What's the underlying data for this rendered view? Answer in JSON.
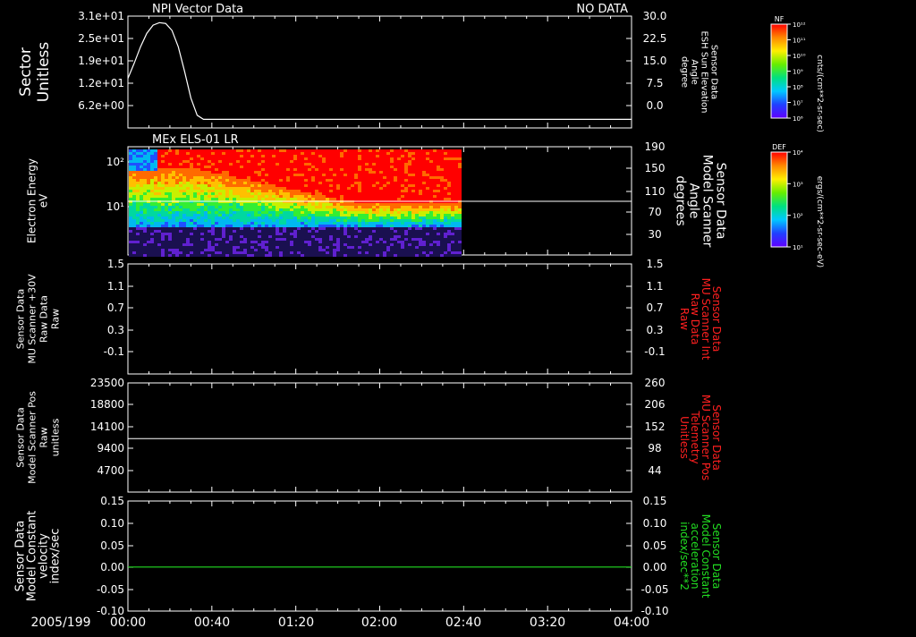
{
  "colors": {
    "background": "#000000",
    "axis": "#ffffff",
    "trace": "#ffffff",
    "red_label": "#ff2020",
    "green_label": "#22dd22"
  },
  "bottom": {
    "date": "2005/199",
    "time_ticks": [
      "00:00",
      "00:40",
      "01:20",
      "02:00",
      "02:40",
      "03:20",
      "04:00"
    ]
  },
  "colorbars": [
    {
      "title": "NF",
      "unit": "cnts/(cm**2-sr-sec)",
      "ticks": [
        "10¹²",
        "10¹¹",
        "10¹⁰",
        "10⁹",
        "10⁸",
        "10⁷",
        "10⁶"
      ]
    },
    {
      "title": "DEF",
      "unit": "ergs/(cm**2-sr-sec-eV)",
      "ticks": [
        "10⁴",
        "10³",
        "10²",
        "10¹"
      ]
    }
  ],
  "chart_data": [
    {
      "type": "line",
      "title": "NPI Vector Data",
      "status": "NO DATA",
      "ylabel": [
        "Sector",
        "Unitless"
      ],
      "yticks": [
        "3.1e+01",
        "2.5e+01",
        "1.9e+01",
        "1.2e+01",
        "6.2e+00"
      ],
      "ylim": [
        3.7,
        31
      ],
      "ylabel_right": [
        "Sensor Data",
        "ESH Sun Elevation",
        "Angle",
        "degree"
      ],
      "yticks_right": [
        "30.0",
        "22.5",
        "15.0",
        "7.5",
        "0.0"
      ],
      "x_minutes": [
        0,
        3,
        6,
        9,
        12,
        15,
        18,
        21,
        24,
        27,
        30,
        33,
        36,
        40,
        60,
        100,
        140,
        180,
        240
      ],
      "y": [
        15.8,
        19.5,
        23.5,
        26.8,
        28.8,
        29.4,
        29.2,
        27.5,
        23.5,
        17.5,
        11.0,
        6.8,
        5.8,
        5.8,
        5.8,
        5.8,
        5.8,
        5.8,
        5.8
      ]
    },
    {
      "type": "heatmap",
      "title": "MEx ELS-01 LR",
      "ylabel": [
        "Electron Energy",
        "eV"
      ],
      "yticks": [
        "10²",
        "10¹"
      ],
      "ylabel_right": [
        "Sensor Data",
        "Model Scanner",
        "Angle",
        "degrees"
      ],
      "yticks_right": [
        "190",
        "150",
        "110",
        "70",
        "30"
      ],
      "data_end_time": "02:38",
      "angle_line_degrees": 85
    },
    {
      "type": "line",
      "ylabel": [
        "Sensor Data",
        "MU Scanner +30V",
        "Raw Data",
        "Raw"
      ],
      "yticks": [
        "1.5",
        "1.1",
        "0.7",
        "0.3",
        "-0.1"
      ],
      "ylabel_right": [
        "Sensor Data",
        "MU Scanner Int",
        "Raw Data",
        "Raw"
      ],
      "yticks_right": [
        "1.5",
        "1.1",
        "0.7",
        "0.3",
        "-0.1"
      ]
    },
    {
      "type": "line",
      "ylabel": [
        "Sensor Data",
        "Model Scanner Pos",
        "Raw",
        "unitless"
      ],
      "yticks": [
        "23500",
        "18800",
        "14100",
        "9400",
        "4700"
      ],
      "ylim": [
        0,
        23500
      ],
      "ylabel_right": [
        "Sensor Data",
        "MU Scanner Pos",
        "Telemetry",
        "Unitless"
      ],
      "yticks_right": [
        "260",
        "206",
        "152",
        "98",
        "44"
      ],
      "x_minutes": [
        0,
        240
      ],
      "y": [
        11500,
        11500
      ]
    },
    {
      "type": "line",
      "ylabel": [
        "Sensor Data",
        "Model Constant",
        "velocity",
        "index/sec"
      ],
      "yticks": [
        "0.15",
        "0.10",
        "0.05",
        "0.00",
        "-0.05",
        "-0.10"
      ],
      "ylim": [
        -0.1,
        0.15
      ],
      "ylabel_right": [
        "Sensor Data",
        "Model Constant",
        "acceleration",
        "index/sec**2"
      ],
      "yticks_right": [
        "0.15",
        "0.10",
        "0.05",
        "0.00",
        "-0.05",
        "-0.10"
      ],
      "x_minutes": [
        0,
        240
      ],
      "y": [
        0.0,
        0.0
      ]
    }
  ]
}
